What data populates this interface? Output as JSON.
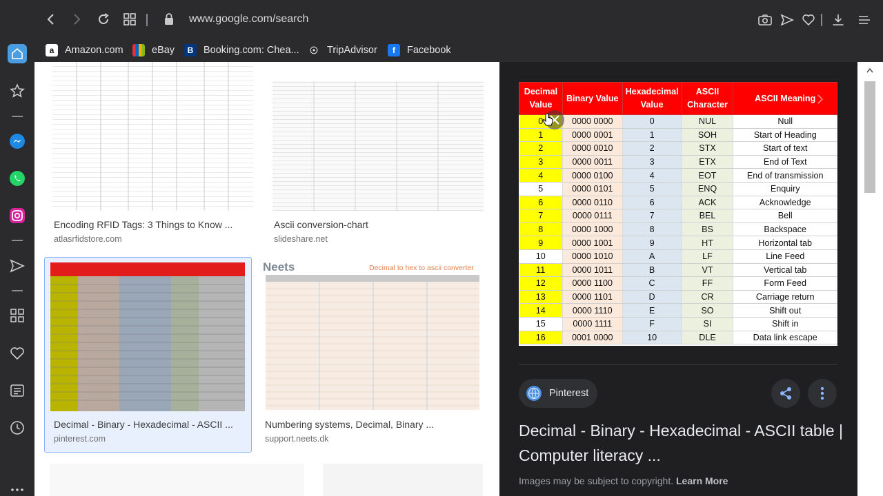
{
  "browser": {
    "url": "www.google.com/search"
  },
  "bookmarks": [
    {
      "label": "Amazon.com",
      "icon": "amazon-icon"
    },
    {
      "label": "eBay",
      "icon": "ebay-icon"
    },
    {
      "label": "Booking.com: Chea...",
      "icon": "booking-icon"
    },
    {
      "label": "TripAdvisor",
      "icon": "tripadvisor-icon"
    },
    {
      "label": "Facebook",
      "icon": "facebook-icon"
    }
  ],
  "results": [
    {
      "title": "Encoding RFID Tags: 3 Things to Know ...",
      "source": "atlasrfidstore.com"
    },
    {
      "title": "Ascii conversion-chart",
      "source": "slideshare.net"
    },
    {
      "title": "Decimal - Binary - Hexadecimal - ASCII ...",
      "source": "pinterest.com"
    },
    {
      "title": "Numbering systems, Decimal, Binary ...",
      "source": "support.neets.dk"
    }
  ],
  "thumbs": {
    "neets_logo": "Neets",
    "neets_caption": "Decimal to hex to ascii converter"
  },
  "preview_table": {
    "headers": [
      "Decimal Value",
      "Binary Value",
      "Hexadecimal Value",
      "ASCII Character",
      "ASCII  Meaning"
    ],
    "rows": [
      [
        "0",
        "0000 0000",
        "0",
        "NUL",
        "Null"
      ],
      [
        "1",
        "0000 0001",
        "1",
        "SOH",
        "Start of Heading"
      ],
      [
        "2",
        "0000 0010",
        "2",
        "STX",
        "Start of text"
      ],
      [
        "3",
        "0000 0011",
        "3",
        "ETX",
        "End of Text"
      ],
      [
        "4",
        "0000 0100",
        "4",
        "EOT",
        "End of transmission"
      ],
      [
        "5",
        "0000 0101",
        "5",
        "ENQ",
        "Enquiry"
      ],
      [
        "6",
        "0000 0110",
        "6",
        "ACK",
        "Acknowledge"
      ],
      [
        "7",
        "0000 0111",
        "7",
        "BEL",
        "Bell"
      ],
      [
        "8",
        "0000 1000",
        "8",
        "BS",
        "Backspace"
      ],
      [
        "9",
        "0000 1001",
        "9",
        "HT",
        "Horizontal tab"
      ],
      [
        "10",
        "0000 1010",
        "A",
        "LF",
        "Line Feed"
      ],
      [
        "11",
        "0000 1011",
        "B",
        "VT",
        "Vertical tab"
      ],
      [
        "12",
        "0000 1100",
        "C",
        "FF",
        "Form Feed"
      ],
      [
        "13",
        "0000 1101",
        "D",
        "CR",
        "Carriage return"
      ],
      [
        "14",
        "0000 1110",
        "E",
        "SO",
        "Shift out"
      ],
      [
        "15",
        "0000 1111",
        "F",
        "SI",
        "Shift in"
      ],
      [
        "16",
        "0001 0000",
        "10",
        "DLE",
        "Data link escape"
      ]
    ],
    "white_rows": [
      5,
      10,
      15
    ]
  },
  "panel": {
    "source_chip": "Pinterest",
    "title": "Decimal - Binary - Hexadecimal - ASCII table | Computer literacy ...",
    "copyright_text": "Images may be subject to copyright.",
    "learn_more": "Learn More"
  },
  "colors": {
    "header_red": "#ff0000",
    "decimal_yellow": "#ffff00",
    "accent_blue": "#8ab4f8"
  }
}
